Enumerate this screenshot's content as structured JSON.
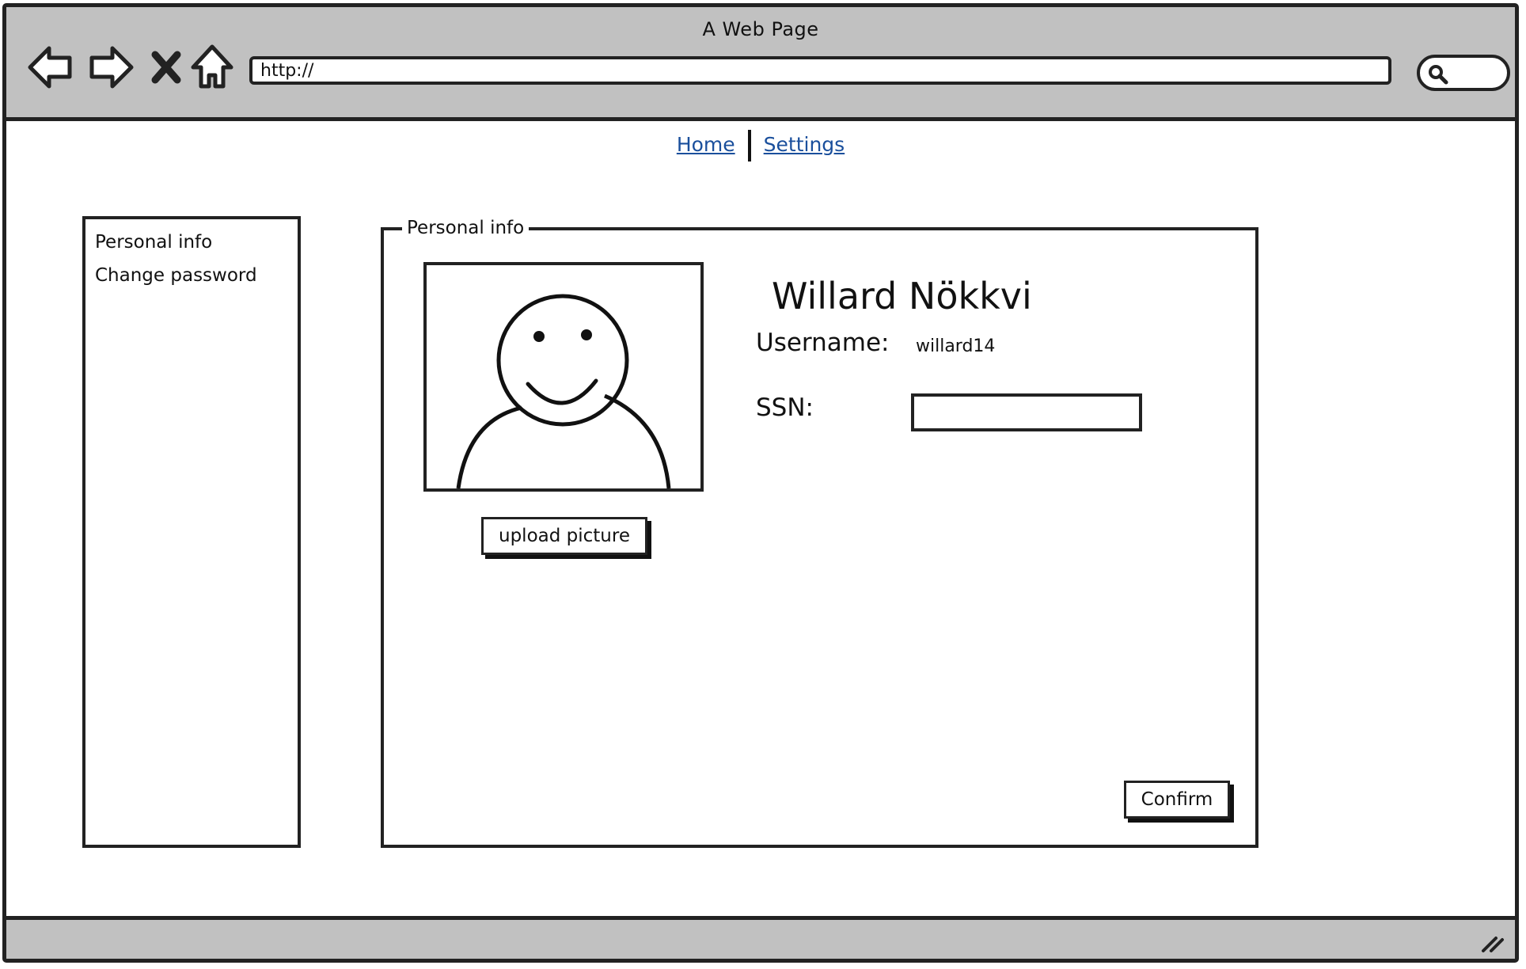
{
  "window": {
    "title": "A Web Page"
  },
  "browser": {
    "address_value": "http://",
    "nav_icons": [
      "back-arrow-icon",
      "forward-arrow-icon",
      "stop-icon",
      "home-icon"
    ],
    "search_icon": "search-icon"
  },
  "top_nav": {
    "links": [
      {
        "label": "Home"
      },
      {
        "label": "Settings"
      }
    ]
  },
  "sidebar": {
    "items": [
      {
        "label": "Personal info"
      },
      {
        "label": "Change password"
      }
    ]
  },
  "panel": {
    "legend": "Personal info",
    "photo_icon": "user-avatar-icon",
    "upload_label": "upload picture",
    "full_name": "Willard Nökkvi",
    "username_label": "Username:",
    "username_value": "willard14",
    "ssn_label": "SSN:",
    "ssn_value": "",
    "confirm_label": "Confirm"
  },
  "statusbar": {
    "resize_icon": "resize-grip-icon"
  }
}
